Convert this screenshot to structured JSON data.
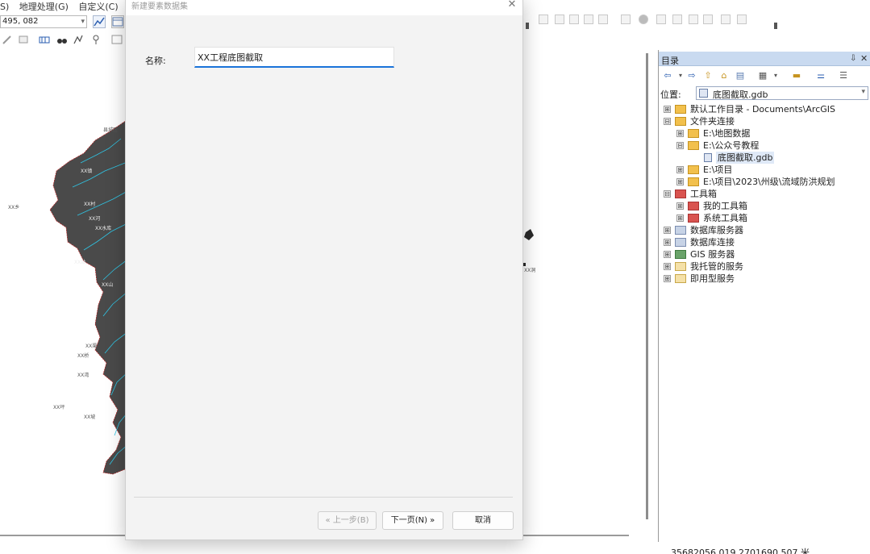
{
  "menu": {
    "items": [
      "S)",
      "地理处理(G)",
      "自定义(C)"
    ]
  },
  "toolbar": {
    "scale_value": "495, 082"
  },
  "dialog": {
    "title": "新建要素数据集",
    "close_glyph": "✕",
    "name_label": "名称:",
    "name_value": "XX工程底图截取",
    "buttons": {
      "back": "« 上一步(B)",
      "next": "下一页(N) »",
      "cancel": "取消"
    }
  },
  "map": {
    "labels": [
      "县城区",
      "XX镇",
      "XX乡",
      "XX村",
      "XX河",
      "XX水库",
      "XX站",
      "XX山",
      "XX渠",
      "XX桥",
      "XX湾",
      "XX坪",
      "XX坡",
      "XX洞"
    ]
  },
  "catalog": {
    "title": "目录",
    "pin_glyph": "⇩",
    "close_glyph": "✕",
    "location_label": "位置:",
    "location_value": "底图截取.gdb",
    "tree": [
      {
        "label": "默认工作目录 - Documents\\ArcGIS",
        "expander": "⊞",
        "icon": "home-folder-icon"
      },
      {
        "label": "文件夹连接",
        "expander": "⊟",
        "icon": "folder-connections-icon"
      },
      {
        "label": "E:\\地图数据",
        "expander": "⊞",
        "icon": "folder-icon"
      },
      {
        "label": "E:\\公众号教程",
        "expander": "⊟",
        "icon": "folder-icon"
      },
      {
        "label": "底图截取.gdb",
        "expander": "",
        "icon": "geodatabase-icon"
      },
      {
        "label": "E:\\项目",
        "expander": "⊞",
        "icon": "folder-icon"
      },
      {
        "label": "E:\\项目\\2023\\州级\\流域防洪规划",
        "expander": "⊞",
        "icon": "folder-icon"
      },
      {
        "label": "工具箱",
        "expander": "⊟",
        "icon": "toolbox-icon"
      },
      {
        "label": "我的工具箱",
        "expander": "⊞",
        "icon": "toolbox-icon"
      },
      {
        "label": "系统工具箱",
        "expander": "⊞",
        "icon": "toolbox-icon"
      },
      {
        "label": "数据库服务器",
        "expander": "⊞",
        "icon": "database-server-icon"
      },
      {
        "label": "数据库连接",
        "expander": "⊞",
        "icon": "database-connection-icon"
      },
      {
        "label": "GIS 服务器",
        "expander": "⊞",
        "icon": "gis-server-icon"
      },
      {
        "label": "我托管的服务",
        "expander": "⊞",
        "icon": "hosted-services-icon"
      },
      {
        "label": "即用型服务",
        "expander": "⊞",
        "icon": "ready-services-icon"
      }
    ]
  },
  "statusbar": {
    "coordinates": "35682056.019  2701690.507 米"
  }
}
